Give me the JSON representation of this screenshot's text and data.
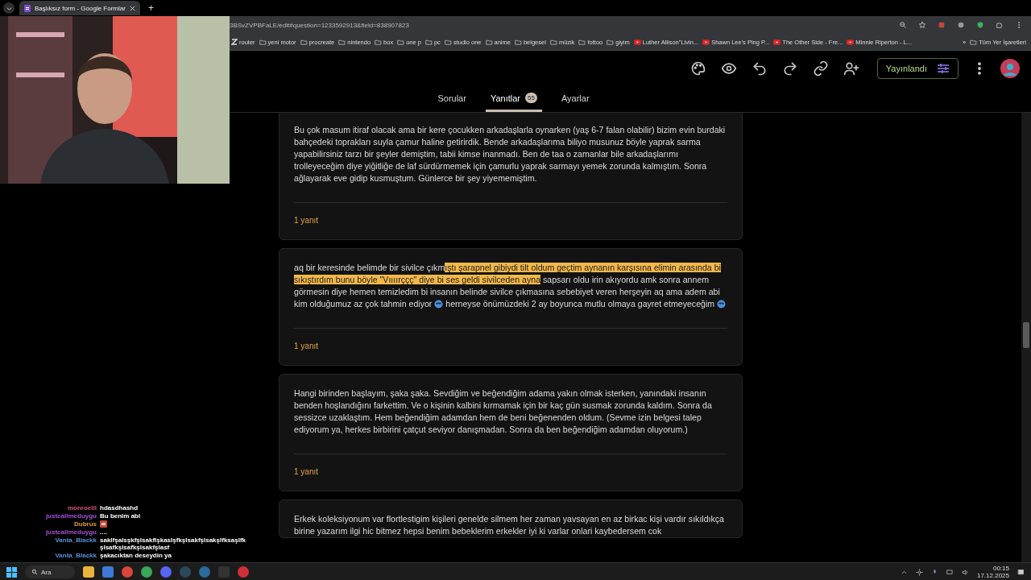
{
  "browser": {
    "tab": {
      "title": "Başlıksız form - Google Formlar",
      "selected": true
    },
    "new_tab": "+",
    "address": "3BSvZVPBFaLE/edit#question=1233592913&field=838907823",
    "bookmarks": [
      {
        "label": "router",
        "kind": "site"
      },
      {
        "label": "yeni motor",
        "kind": "folder"
      },
      {
        "label": "procreate",
        "kind": "folder"
      },
      {
        "label": "nintendo",
        "kind": "folder"
      },
      {
        "label": "box",
        "kind": "folder"
      },
      {
        "label": "one p",
        "kind": "folder"
      },
      {
        "label": "pc",
        "kind": "folder"
      },
      {
        "label": "studio one",
        "kind": "folder"
      },
      {
        "label": "anime",
        "kind": "folder"
      },
      {
        "label": "belgesel",
        "kind": "folder"
      },
      {
        "label": "müzik",
        "kind": "folder"
      },
      {
        "label": "fottoo",
        "kind": "folder"
      },
      {
        "label": "giyim",
        "kind": "folder"
      },
      {
        "label": "Luther Allison\"Livin...",
        "kind": "video"
      },
      {
        "label": "Shawn Lee's Ping P...",
        "kind": "video"
      },
      {
        "label": "The Other Side - Fre...",
        "kind": "video"
      },
      {
        "label": "Minnie Riperton - L...",
        "kind": "video"
      }
    ],
    "bookmarks_more": "»",
    "all_bookmarks": "Tüm Yer İşaretleri"
  },
  "form_header": {
    "publish_button": "Yayınlandı"
  },
  "tabs": [
    {
      "label": "Sorular",
      "selected": false
    },
    {
      "label": "Yanıtlar",
      "selected": true,
      "badge": "55"
    },
    {
      "label": "Ayarlar",
      "selected": false
    }
  ],
  "responses": [
    {
      "segments": [
        {
          "kind": "text",
          "text": "Bu çok masum itiraf olacak ama bir kere çocukken arkadaşlarla oynarken (yaş 6-7 falan olabilir) bizim evin burdaki bahçedeki toprakları suyla çamur haline getirirdik. Bende arkadaşlarıma biliyo musunuz böyle yaprak sarma yapabilirsiniz tarzı bir şeyler demiştim, tabii kimse inanmadı. Ben de taa o zamanlar bile arkadaşlarımı trolleyeceğim diye yiğitliğe de laf sürdürmemek için çamurlu yaprak sarmayı yemek zorunda kalmıştım. Sonra ağlayarak eve gidip kusmuştum. Günlerce bir şey yiyememiştim.",
          "highlighted": false
        }
      ],
      "reply_count": "1 yanıt"
    },
    {
      "segments": [
        {
          "kind": "text",
          "text": "aq bir keresinde belimde bir sivilce çıkm",
          "highlighted": false
        },
        {
          "kind": "text",
          "text": "ıştı şarapnel gibiydi tilt oldum geçtim aynanın karşısına elimin arasında bi sıkıştırdım bunu böyle \"Vıııırççç\" diye bi ses geldi sivilceden ayna",
          "highlighted": true
        },
        {
          "kind": "text",
          "text": " sapsarı oldu irin akıyordu amk sonra annem görmesin diye hemen temizledim bi insanın belinde sivilce çıkmasına sebebiyet veren herşeyin aq ama adem abi kim olduğumuz az çok tahmin ediyor ",
          "highlighted": false
        },
        {
          "kind": "emoji"
        },
        {
          "kind": "text",
          "text": " herneyse önümüzdeki 2 ay boyunca mutlu olmaya gayret etmeyeceğim ",
          "highlighted": false
        },
        {
          "kind": "emoji"
        }
      ],
      "reply_count": "1 yanıt"
    },
    {
      "segments": [
        {
          "kind": "text",
          "text": "Hangi birinden başlayım, şaka şaka. Sevdiğim ve beğendiğim adama yakın olmak isterken, yanındaki insanın benden hoşlandığını farkettim. Ve o kişinin kalbini kırmamak için bir kaç gün susmak zorunda kaldım. Sonra da sessizce uzaklaştım. Hem beğendiğim adamdan hem de beni beğenenden oldum. (Sevme izin belgesi talep ediyorum ya, herkes birbirini çatçut seviyor danışmadan. Sonra da ben beğendiğim adamdan oluyorum.)",
          "highlighted": false
        }
      ],
      "reply_count": "1 yanıt"
    },
    {
      "segments": [
        {
          "kind": "text",
          "text": "Erkek koleksiyonum var flortlestigim kişileri genelde silmem her zaman yavsayan en az birkac kişi vardır sıkıldıkça birine yazarım ilgi hic bitmez hepsi benim bebeklerim erkekler iyi ki varlar onlari kaybedersem cok",
          "highlighted": false
        }
      ]
    }
  ],
  "chat": [
    {
      "user": "monroelll",
      "color": "#d9566e",
      "kind": "text",
      "message": "hdasdhashd"
    },
    {
      "user": "justcallmeduygu",
      "color": "#a64fdc",
      "kind": "text",
      "message": "Bu benim abi"
    },
    {
      "user": "Dubrus",
      "color": "#e39b2c",
      "kind": "emote"
    },
    {
      "user": "justcallmeduygu",
      "color": "#a64fdc",
      "kind": "text",
      "message": "...."
    },
    {
      "user": "Vanta_Blackk",
      "color": "#5b8fd8",
      "kind": "text",
      "message": "saklfşalsşkfşlsakflşkaslşfkşlsakfşlsakşlfksaşlfk şlsafkşlsafkşlsakfşlasf"
    },
    {
      "user": "Vanta_Blackk",
      "color": "#5b8fd8",
      "kind": "text",
      "message": "şakacıktan deseydin ya"
    }
  ],
  "taskbar": {
    "search": "Ara",
    "time": "00:15",
    "date": "17.12.2025"
  }
}
